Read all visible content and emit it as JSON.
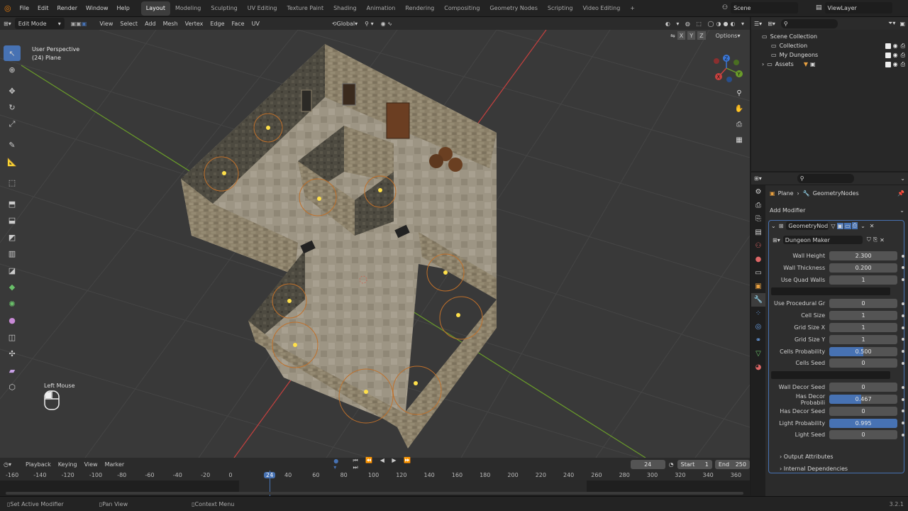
{
  "menu": [
    "File",
    "Edit",
    "Render",
    "Window",
    "Help"
  ],
  "workspaces": [
    "Layout",
    "Modeling",
    "Sculpting",
    "UV Editing",
    "Texture Paint",
    "Shading",
    "Animation",
    "Rendering",
    "Compositing",
    "Geometry Nodes",
    "Scripting",
    "Video Editing"
  ],
  "scene": "Scene",
  "view_layer": "ViewLayer",
  "vp_header": {
    "mode": "Edit Mode",
    "menus": [
      "View",
      "Select",
      "Add",
      "Mesh",
      "Vertex",
      "Edge",
      "Face",
      "UV"
    ],
    "transform": "Global",
    "options": "Options",
    "axes": [
      "X",
      "Y",
      "Z"
    ]
  },
  "overlay_text": {
    "perspective": "User Perspective",
    "object": "(24) Plane",
    "left_mouse": "Left Mouse"
  },
  "gizmo": {
    "x": "X",
    "y": "Y",
    "z": "Z"
  },
  "timeline": {
    "menus": [
      "Playback",
      "Keying",
      "View",
      "Marker"
    ],
    "current_frame": "24",
    "start_label": "Start",
    "start": "1",
    "end_label": "End",
    "end": "250",
    "ruler": [
      "-160",
      "-140",
      "-120",
      "-100",
      "-80",
      "-60",
      "-40",
      "-20",
      "0",
      "24",
      "40",
      "60",
      "80",
      "100",
      "120",
      "140",
      "160",
      "180",
      "200",
      "220",
      "240",
      "260",
      "280",
      "300",
      "320",
      "340",
      "360"
    ]
  },
  "status": {
    "items": [
      "Set Active Modifier",
      "Pan View",
      "Context Menu"
    ],
    "version": "3.2.1"
  },
  "outliner": {
    "items": [
      {
        "label": "Scene Collection"
      },
      {
        "label": "Collection"
      },
      {
        "label": "My Dungeons"
      },
      {
        "label": "Assets"
      }
    ]
  },
  "properties": {
    "breadcrumb": {
      "object": "Plane",
      "modifier": "GeometryNodes"
    },
    "add_modifier": "Add Modifier",
    "modifier_name": "GeometryNod...",
    "node_group": "Dungeon Maker",
    "params": [
      {
        "label": "Wall Height",
        "value": "2.300",
        "fraction": 0
      },
      {
        "label": "Wall Thickness",
        "value": "0.200",
        "fraction": 0
      },
      {
        "label": "Use Quad Walls",
        "value": "1",
        "fraction": 0
      },
      {
        "sep": true
      },
      {
        "label": "Use Procedural Gr",
        "value": "0",
        "fraction": 0
      },
      {
        "label": "Cell Size",
        "value": "1",
        "fraction": 0
      },
      {
        "label": "Grid Size X",
        "value": "1",
        "fraction": 0
      },
      {
        "label": "Grid Size Y",
        "value": "1",
        "fraction": 0
      },
      {
        "label": "Cells Probability",
        "value": "0.500",
        "fraction": 0.5
      },
      {
        "label": "Cells Seed",
        "value": "0",
        "fraction": 0
      },
      {
        "sep": true
      },
      {
        "label": "Wall Decor Seed",
        "value": "0",
        "fraction": 0
      },
      {
        "label": "Has Decor Probabili",
        "value": "0.467",
        "fraction": 0.467
      },
      {
        "label": "Has Decor Seed",
        "value": "0",
        "fraction": 0
      },
      {
        "label": "Light Probability",
        "value": "0.995",
        "fraction": 0.995
      },
      {
        "label": "Light Seed",
        "value": "0",
        "fraction": 0
      }
    ],
    "sections": [
      "Output Attributes",
      "Internal Dependencies"
    ]
  },
  "colors": {
    "accent": "#4772b3",
    "x_axis": "#c8413f",
    "y_axis": "#6a9c2a",
    "z_axis": "#3a76d6"
  }
}
